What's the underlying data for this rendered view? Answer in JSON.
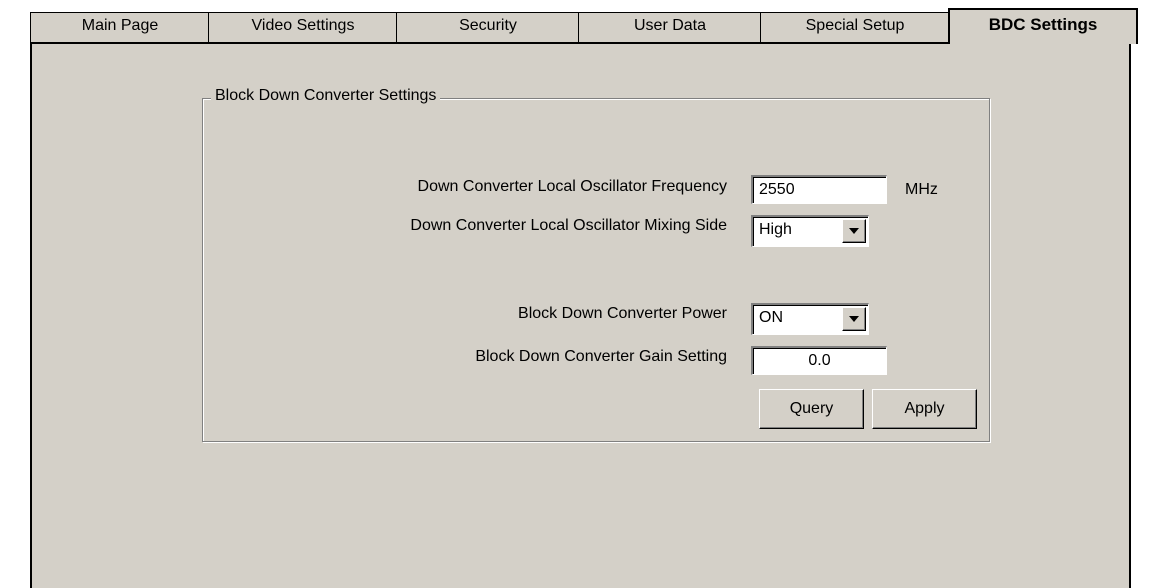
{
  "tabs": [
    {
      "label": "Main Page"
    },
    {
      "label": "Video Settings"
    },
    {
      "label": "Security"
    },
    {
      "label": "User Data"
    },
    {
      "label": "Special Setup"
    },
    {
      "label": "BDC Settings",
      "active": true
    }
  ],
  "group": {
    "title": "Block Down Converter Settings",
    "fields": {
      "lo_frequency": {
        "label": "Down Converter Local Oscillator Frequency",
        "value": "2550",
        "unit": "MHz"
      },
      "lo_mixing_side": {
        "label": "Down Converter Local Oscillator Mixing Side",
        "value": "High"
      },
      "power": {
        "label": "Block Down Converter Power",
        "value": "ON"
      },
      "gain": {
        "label": "Block Down Converter Gain Setting",
        "value": "0.0"
      }
    },
    "buttons": {
      "query": "Query",
      "apply": "Apply"
    }
  }
}
